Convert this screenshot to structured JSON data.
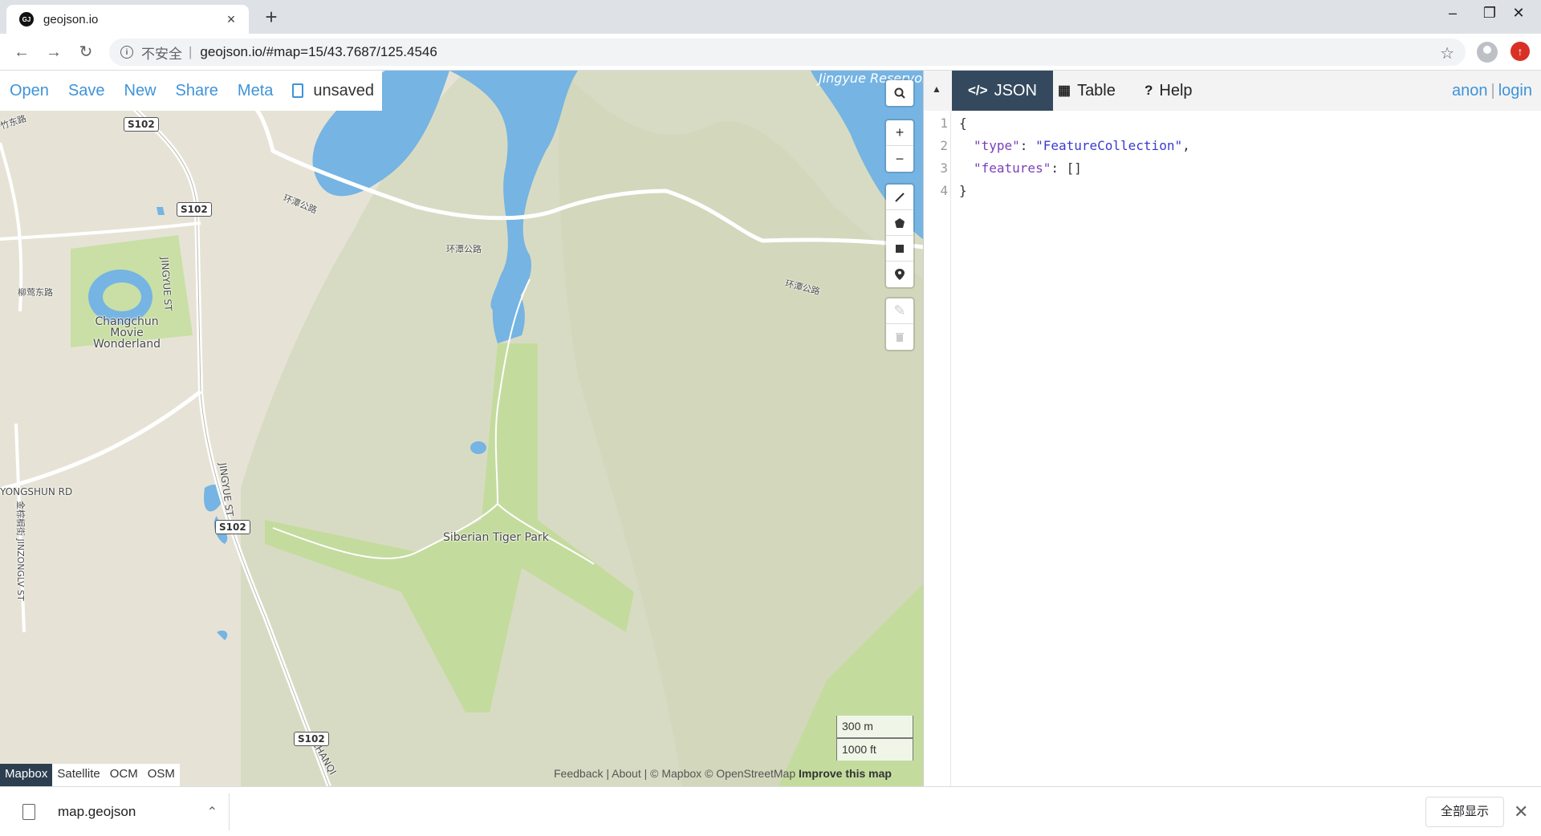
{
  "browser": {
    "tab_title": "geojson.io",
    "tab_favicon": "GJ",
    "tab_close": "×",
    "new_tab": "+",
    "window_minimize": "–",
    "window_restore": "❐",
    "window_close": "✕",
    "insecure_label": "不安全",
    "url_separator": "|",
    "url": "geojson.io/#map=15/43.7687/125.4546"
  },
  "menu": {
    "open": "Open",
    "save": "Save",
    "new": "New",
    "share": "Share",
    "meta": "Meta",
    "file_status": "unsaved"
  },
  "map_labels": {
    "reservoir": "Jingyue Reservoir",
    "movie_wonderland": "Changchun Movie Wonderland",
    "tiger_park": "Siberian Tiger Park",
    "huantan_road": "环潭公路",
    "liuying_road": "柳莺东路",
    "jingyue_st": "JINGYUE ST",
    "yongshun_rd": "YONGSHUN RD",
    "jinzonglv_st": "金棕榈街 JINZONGLV ST",
    "changqing": "CHANQI",
    "zhuhua_road": "竹东路",
    "s102": "S102"
  },
  "scale": {
    "metric": "300 m",
    "imperial": "1000 ft"
  },
  "layers": [
    "Mapbox",
    "Satellite",
    "OCM",
    "OSM"
  ],
  "active_layer": "Mapbox",
  "attribution": {
    "feedback": "Feedback",
    "about": "About",
    "mapbox": "© Mapbox",
    "osm": "© OpenStreetMap",
    "improve": "Improve this map"
  },
  "pane": {
    "tabs": [
      {
        "icon": "</>",
        "label": "JSON"
      },
      {
        "icon": "▦",
        "label": "Table"
      },
      {
        "icon": "?",
        "label": "Help"
      }
    ],
    "active_tab": "JSON",
    "user": "anon",
    "login": "login"
  },
  "editor": {
    "line_numbers": [
      "1",
      "2",
      "3",
      "4"
    ],
    "open_brace": "{",
    "key_type": "\"type\"",
    "val_type": "\"FeatureCollection\"",
    "key_features": "\"features\"",
    "val_features": "[]",
    "close_brace": "}"
  },
  "downloads": {
    "filename": "map.geojson",
    "show_all": "全部显示",
    "close": "✕"
  },
  "colors": {
    "water": "#75b4e3",
    "land": "#e6e3d6",
    "hill": "#d6d9c0",
    "park": "#c4db9e",
    "accent_blue": "#3f93d8",
    "active_tab": "#34495e"
  }
}
